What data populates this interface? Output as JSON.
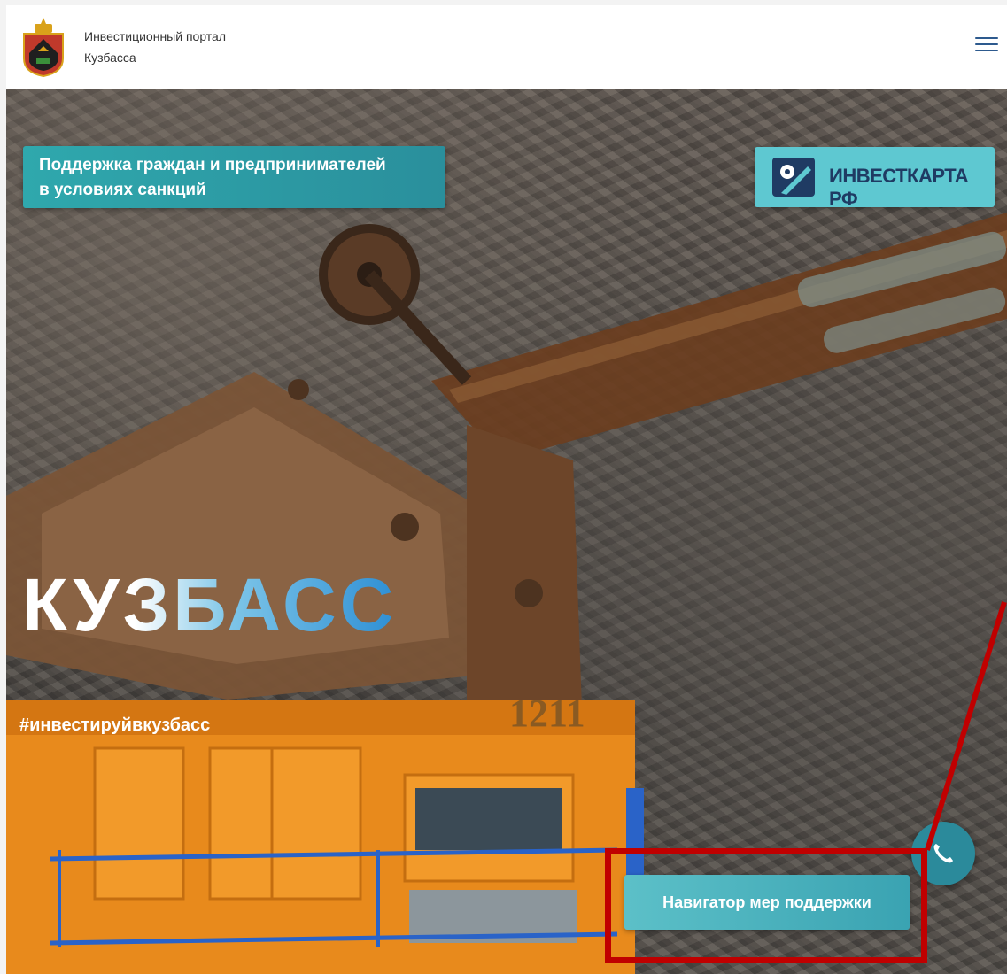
{
  "header": {
    "brand_line1": "Инвестиционный портал",
    "brand_line2": "Кузбасса",
    "menu_icon": "hamburger-menu-icon",
    "menu_color": "#2d5a8e"
  },
  "hero": {
    "support_banner_line1": "Поддержка граждан и предпринимателей",
    "support_banner_line2": "в условиях санкций",
    "investkarta_label": "ИНВЕСТКАРТА РФ",
    "kuzbass_title": "КУЗБАСС",
    "hashtag": "#инвестируйвкузбасс",
    "truck_number": "1211",
    "navigator_button": "Навигатор мер поддержки",
    "phone_icon": "phone-icon"
  },
  "colors": {
    "teal_banner": "#2fa8ad",
    "highlight_red": "#c00000",
    "investkarta_bg": "#5ec8d1"
  }
}
